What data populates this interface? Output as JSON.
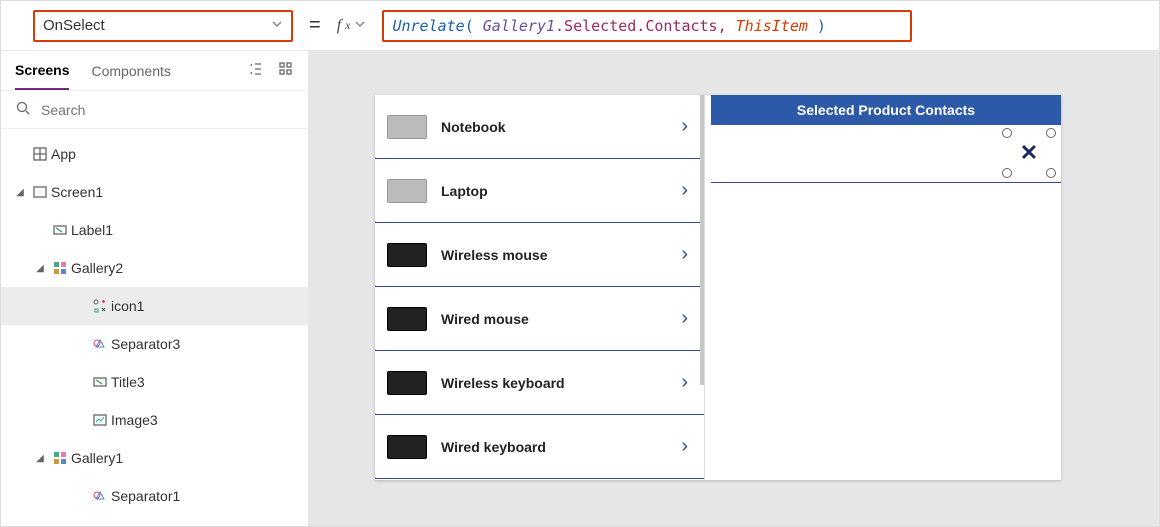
{
  "formula_bar": {
    "property": "OnSelect",
    "equals": "=",
    "fx_label": "fx",
    "formula_tokens": {
      "fn": "Unrelate",
      "lp": "( ",
      "obj": "Gallery1",
      "mem": ".Selected.Contacts, ",
      "kw": "ThisItem",
      "rp": " )"
    }
  },
  "panel": {
    "tab_screens": "Screens",
    "tab_components": "Components",
    "search_placeholder": "Search"
  },
  "tree": {
    "app": "App",
    "screen1": "Screen1",
    "label1": "Label1",
    "gallery2": "Gallery2",
    "icon1": "icon1",
    "separator3": "Separator3",
    "title3": "Title3",
    "image3": "Image3",
    "gallery1": "Gallery1",
    "separator1": "Separator1"
  },
  "preview": {
    "products": [
      {
        "name": "Notebook",
        "dark": false
      },
      {
        "name": "Laptop",
        "dark": false
      },
      {
        "name": "Wireless mouse",
        "dark": true
      },
      {
        "name": "Wired mouse",
        "dark": true
      },
      {
        "name": "Wireless keyboard",
        "dark": true
      },
      {
        "name": "Wired keyboard",
        "dark": true
      }
    ],
    "contacts_header": "Selected Product Contacts"
  }
}
